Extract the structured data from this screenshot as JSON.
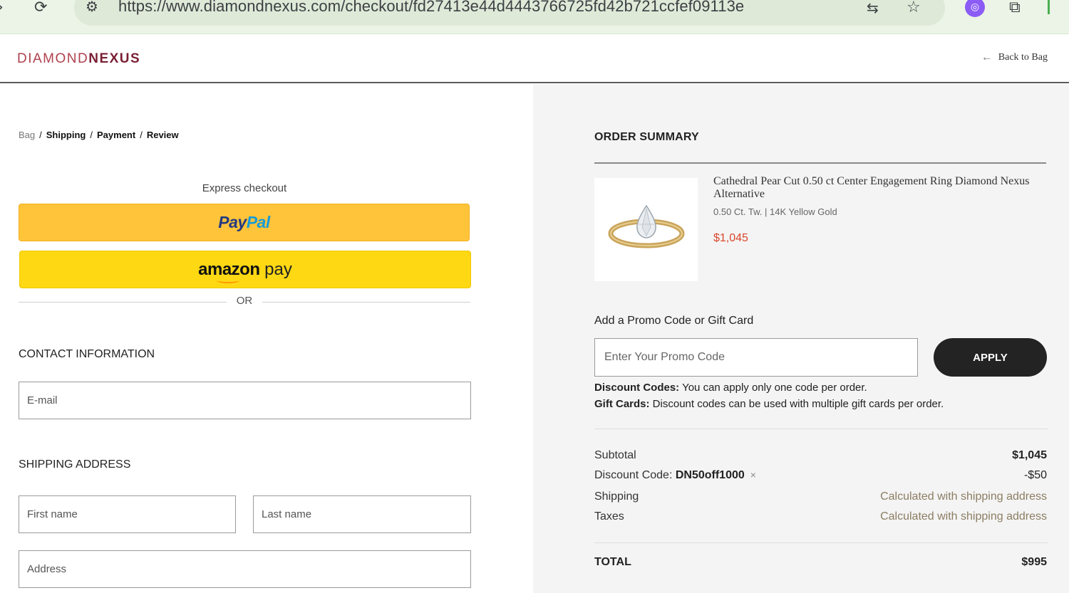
{
  "browser": {
    "url": "https://www.diamondnexus.com/checkout/fd27413e44d4443766725fd42b721ccfef09113e"
  },
  "header": {
    "logo_part1": "DIAMOND",
    "logo_part2": "NEXUS",
    "back_label": "Back to Bag"
  },
  "breadcrumb": [
    {
      "label": "Bag",
      "active": false
    },
    {
      "label": "Shipping",
      "active": true
    },
    {
      "label": "Payment",
      "active": true
    },
    {
      "label": "Review",
      "active": true
    }
  ],
  "breadcrumb_separator": "/",
  "express": {
    "label": "Express checkout",
    "paypal_part1": "Pay",
    "paypal_part2": "Pal",
    "amazon_part1": "amazon",
    "amazon_part2": "pay",
    "or_label": "OR"
  },
  "contact": {
    "title": "CONTACT INFORMATION",
    "email_placeholder": "E-mail",
    "email_value": ""
  },
  "shipping": {
    "title": "SHIPPING ADDRESS",
    "first_name_placeholder": "First name",
    "last_name_placeholder": "Last name",
    "address_placeholder": "Address"
  },
  "summary": {
    "title": "ORDER SUMMARY",
    "product": {
      "name": "Cathedral Pear Cut 0.50 ct Center Engagement Ring Diamond Nexus Alternative",
      "spec": "0.50 Ct. Tw. | 14K Yellow Gold",
      "price": "$1,045"
    },
    "promo_label": "Add a Promo Code or Gift Card",
    "promo_placeholder": "Enter Your Promo Code",
    "apply_label": "APPLY",
    "note1_bold": "Discount Codes:",
    "note1_text": " You can apply only one code per order.",
    "note2_bold": "Gift Cards:",
    "note2_text": " Discount codes can be used with multiple gift cards per order.",
    "subtotal_label": "Subtotal",
    "subtotal_value": "$1,045",
    "discount_label": "Discount Code: ",
    "discount_code": "DN50off1000",
    "discount_remove": "×",
    "discount_value": "-$50",
    "shipping_label": "Shipping",
    "shipping_value": "Calculated with shipping address",
    "taxes_label": "Taxes",
    "taxes_value": "Calculated with shipping address",
    "total_label": "TOTAL",
    "total_value": "$995"
  },
  "colors": {
    "paypal_button": "#ffc43a",
    "amazon_button": "#ffd814",
    "apply_button": "#232323",
    "price_accent": "#d9472b",
    "logo_accent": "#7a1f33"
  }
}
